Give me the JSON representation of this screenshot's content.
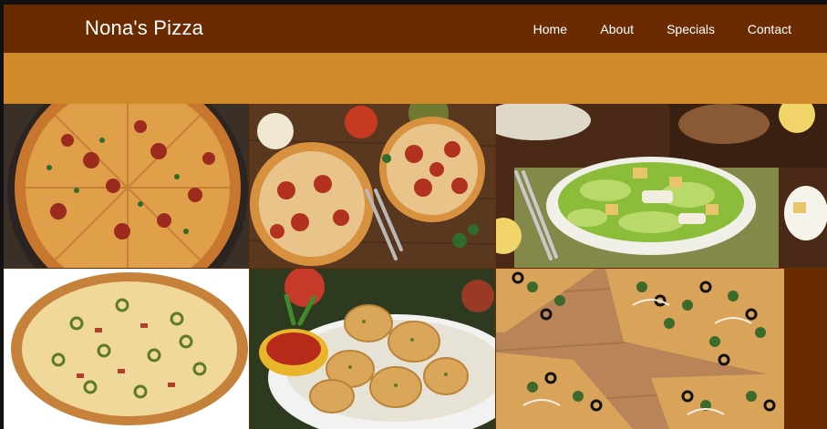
{
  "site": {
    "brand": "Nona's Pizza"
  },
  "nav": {
    "items": [
      {
        "label": "Home"
      },
      {
        "label": "About"
      },
      {
        "label": "Specials"
      },
      {
        "label": "Contact"
      }
    ]
  },
  "gallery": {
    "tiles": [
      {
        "subject": "pepperoni pizza on pan"
      },
      {
        "subject": "pizzas on wooden table"
      },
      {
        "subject": "chicken caesar salad"
      },
      {
        "subject": "jalapeno pizza"
      },
      {
        "subject": "garlic knots with sauce"
      },
      {
        "subject": "spinach olive pizza slices"
      }
    ]
  },
  "colors": {
    "header": "#6b2b00",
    "band": "#d08a2b",
    "text": "#ffffff"
  }
}
